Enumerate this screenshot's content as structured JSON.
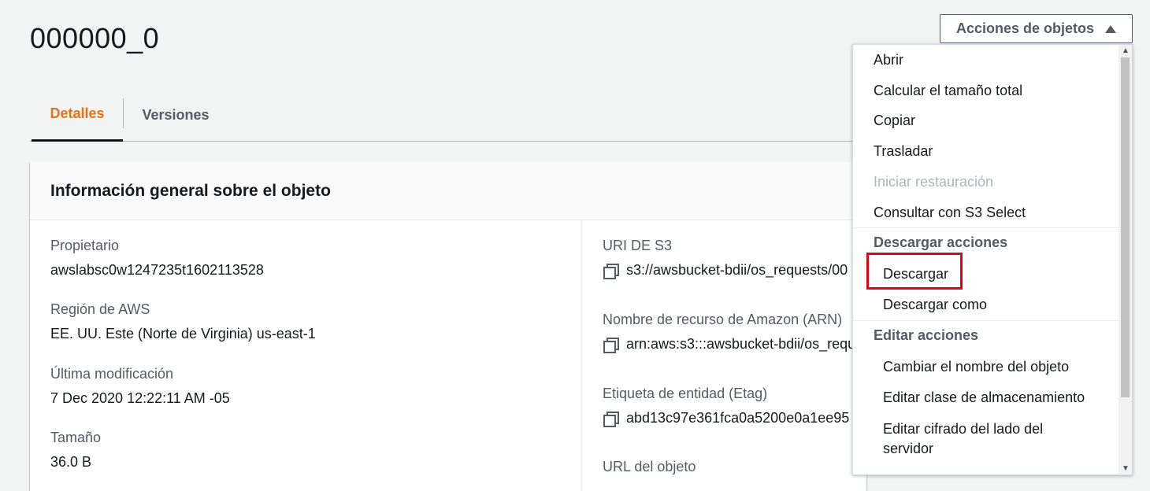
{
  "page": {
    "title": "000000_0"
  },
  "tabs": [
    {
      "label": "Detalles",
      "active": true
    },
    {
      "label": "Versiones",
      "active": false
    }
  ],
  "panel": {
    "title": "Información general sobre el objeto",
    "left": [
      {
        "label": "Propietario",
        "value": "awslabsc0w1247235t1602113528"
      },
      {
        "label": "Región de AWS",
        "value": "EE. UU. Este (Norte de Virginia) us-east-1"
      },
      {
        "label": "Última modificación",
        "value": "7 Dec 2020 12:22:11 AM -05"
      },
      {
        "label": "Tamaño",
        "value": "36.0 B"
      }
    ],
    "right": [
      {
        "label": "URI DE S3",
        "value": "s3://awsbucket-bdii/os_requests/00",
        "icon": "copy-icon"
      },
      {
        "label": "Nombre de recurso de Amazon (ARN)",
        "value": "arn:aws:s3:::awsbucket-bdii/os_requ",
        "icon": "copy-icon"
      },
      {
        "label": "Etiqueta de entidad (Etag)",
        "value": "abd13c97e361fca0a5200e0a1ee95",
        "icon": "copy-icon"
      },
      {
        "label": "URL del objeto",
        "value": ""
      }
    ]
  },
  "actions": {
    "button_label": "Acciones de objetos",
    "button_icon": "caret-up-icon",
    "menu": {
      "items_top": [
        "Abrir",
        "Calcular el tamaño total",
        "Copiar",
        "Trasladar",
        "Iniciar restauración",
        "Consultar con S3 Select"
      ],
      "disabled": [
        "Iniciar restauración"
      ],
      "group_download": {
        "label": "Descargar acciones",
        "items": [
          "Descargar",
          "Descargar como"
        ]
      },
      "group_edit": {
        "label": "Editar acciones",
        "items": [
          "Cambiar el nombre del objeto",
          "Editar clase de almacenamiento",
          "Editar cifrado del lado del",
          "servidor"
        ]
      }
    }
  },
  "colors": {
    "accent": "#ec7211",
    "highlight": "#e3000f",
    "background": "#f2f3f3"
  }
}
